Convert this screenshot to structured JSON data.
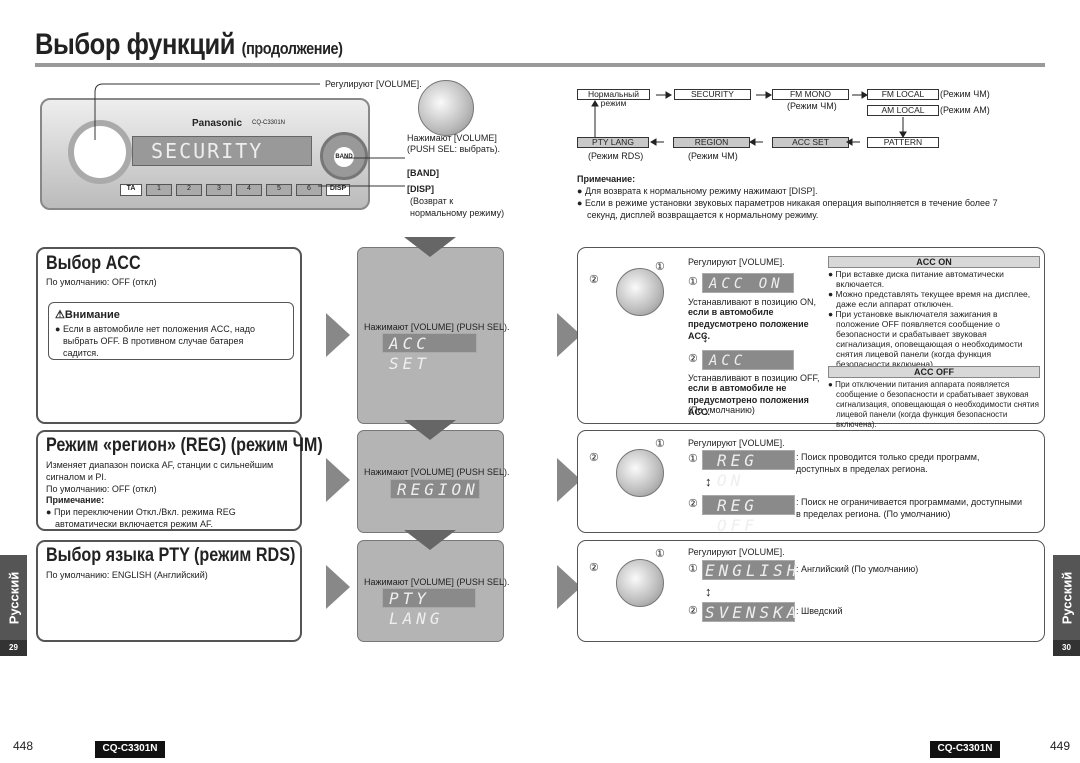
{
  "title": "Выбор функций",
  "title_suffix": "(продолжение)",
  "radio": {
    "brand": "Panasonic",
    "model": "CQ-C3301N",
    "display": "SECURITY",
    "buttons": [
      "TA",
      "1",
      "2",
      "3",
      "4",
      "5",
      "6",
      "DISP"
    ],
    "band": "BAND"
  },
  "callouts": {
    "volume_turn": "Регулируют [VOLUME].",
    "volume_push": "Нажимают [VOLUME]",
    "push_sel": "(PUSH SEL: выбрать).",
    "band": "[BAND]",
    "disp": "[DISP]",
    "disp_note": "(Возврат к нормальному режиму)"
  },
  "flow": {
    "normal": "Нормальный режим",
    "security": "SECURITY",
    "fm_mono": "FM MONO",
    "fm_mono_note": "(Режим ЧМ)",
    "fm_local": "FM LOCAL",
    "fm_local_note": "(Режим ЧМ)",
    "am_local": "AM LOCAL",
    "am_local_note": "(Режим АМ)",
    "pattern": "PATTERN",
    "acc_set": "ACC SET",
    "region": "REGION",
    "region_note": "(Режим ЧМ)",
    "pty_lang": "PTY LANG",
    "pty_note": "(Режим RDS)"
  },
  "note": {
    "head": "Примечание:",
    "items": [
      "Для возврата к нормальному режиму нажимают [DISP].",
      "Если в режиме установки звуковых параметров никакая операция выполняется в течение более 7 секунд, дисплей возвращается к нормальному режиму."
    ]
  },
  "acc": {
    "title": "Выбор ACC",
    "default": "По умолчанию: OFF (откл)",
    "warn_title": "Внимание",
    "warn_text": "Если в автомобиле нет положения ACC, надо выбрать OFF.  В противном случае батарея садится.",
    "press": "Нажимают [VOLUME] (PUSH SEL).",
    "lcd": "ACC SET",
    "turn": "Регулируют [VOLUME].",
    "on_lcd": "ACC ON",
    "on_desc": "Устанавливают в позицию ON,",
    "on_bold": "если в автомобиле предусмотрено положение ACC.",
    "off_lcd": "ACC OFF",
    "off_desc": "Устанавливают в позицию OFF,",
    "off_bold": "если в автомобиле не предусмотрено положения ACC.",
    "off_default": "(По умолчанию)",
    "on_head": "ACC ON",
    "on_items": [
      "При вставке диска питание автоматически включается.",
      "Можно представлять текущее время на дисплее, даже если аппарат отключен.",
      "При установке выключателя зажигания в положение OFF появляется сообщение о безопасности и срабатывает звуковая сигнализация, оповещающая о необходимости снятия лицевой панели (когда функция безопасности включена)."
    ],
    "off_head": "ACC OFF",
    "off_items": [
      "При отключении питания аппарата появляется сообщение о безопасности и срабатывает звуковая сигнализация, оповещающая о необходимости снятия лицевой панели (когда функция безопасности включена)."
    ]
  },
  "reg": {
    "title": "Режим «регион» (REG) (режим ЧМ)",
    "desc": "Изменяет диапазон поиска AF, станции с сильнейшим сигналом и PI.",
    "default": "По умолчанию: OFF (откл)",
    "note_head": "Примечание:",
    "note": "При переключении Откл./Вкл. режима REG автоматически включается режим AF.",
    "press": "Нажимают [VOLUME] (PUSH SEL).",
    "lcd": "REGION",
    "turn": "Регулируют [VOLUME].",
    "on_lcd": "REG ON",
    "on_desc": ": Поиск проводится только среди программ, доступных в пределах региона.",
    "off_lcd": "REG OFF",
    "off_desc": ": Поиск не ограничивается программами, доступными в пределах региона. (По умолчанию)"
  },
  "pty": {
    "title": "Выбор языка PTY (режим RDS)",
    "default": "По умолчанию: ENGLISH (Английский)",
    "press": "Нажимают [VOLUME] (PUSH SEL).",
    "lcd": "PTY LANG",
    "turn": "Регулируют [VOLUME].",
    "l1": "ENGLISH",
    "l1_desc": ": Английский (По умолчанию)",
    "l2": "SVENSKA",
    "l2_desc": ": Шведский"
  },
  "markers": {
    "one": "①",
    "two": "②"
  },
  "side": {
    "lang": "Русский",
    "left_page": "29",
    "right_page": "30"
  },
  "footer": {
    "left_num": "448",
    "right_num": "449",
    "model": "CQ-C3301N"
  }
}
